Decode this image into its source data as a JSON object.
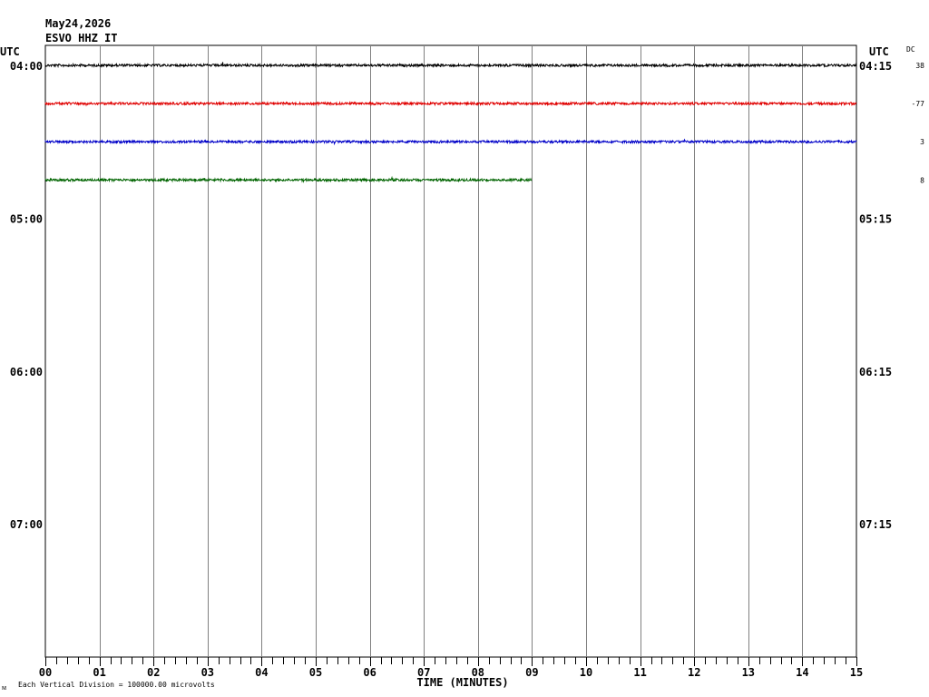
{
  "header": {
    "date": "May24,2026",
    "station": "ESVO HHZ IT",
    "utc_left": "UTC",
    "utc_right": "UTC",
    "dc_label": "DC"
  },
  "footer": {
    "xlabel": "TIME (MINUTES)",
    "division_note": "Each Vertical Division = 100000.00 microvolts",
    "corner_mark": "ᴍ"
  },
  "colors": {
    "black": "#000000",
    "red": "#e00000",
    "blue": "#0000c8",
    "green": "#006400",
    "grid": "#808080"
  },
  "chart_data": {
    "type": "line",
    "title": "",
    "xlabel": "TIME (MINUTES)",
    "x_ticks": [
      "00",
      "01",
      "02",
      "03",
      "04",
      "05",
      "06",
      "07",
      "08",
      "09",
      "10",
      "11",
      "12",
      "13",
      "14",
      "15"
    ],
    "xlim": [
      0,
      15
    ],
    "rows_left_labels": [
      {
        "row": 0,
        "text": "04:00"
      },
      {
        "row": 4,
        "text": "05:00"
      },
      {
        "row": 8,
        "text": "06:00"
      },
      {
        "row": 12,
        "text": "07:00"
      }
    ],
    "rows_right_labels": [
      {
        "row": 0,
        "text": "04:15"
      },
      {
        "row": 4,
        "text": "05:15"
      },
      {
        "row": 8,
        "text": "06:15"
      },
      {
        "row": 12,
        "text": "07:15"
      }
    ],
    "total_rows": 16,
    "series": [
      {
        "row": 0,
        "color": "#000000",
        "x_start": 0,
        "x_end": 15,
        "dc": "38"
      },
      {
        "row": 1,
        "color": "#e00000",
        "x_start": 0,
        "x_end": 15,
        "dc": "-77"
      },
      {
        "row": 2,
        "color": "#0000c8",
        "x_start": 0,
        "x_end": 15,
        "dc": "3"
      },
      {
        "row": 3,
        "color": "#006400",
        "x_start": 0,
        "x_end": 9,
        "dc": "8"
      }
    ]
  }
}
